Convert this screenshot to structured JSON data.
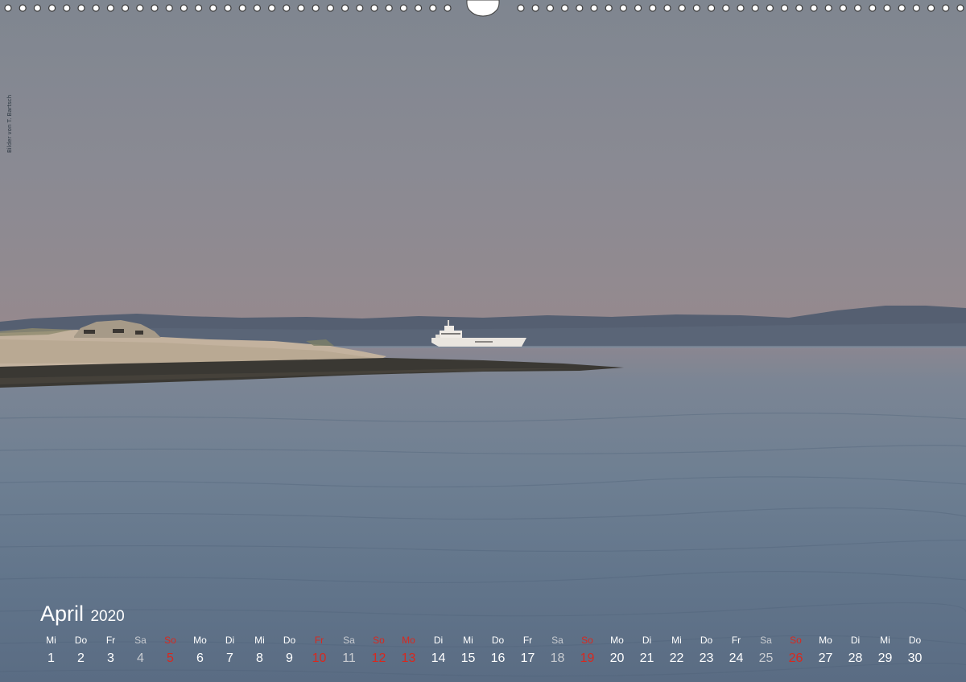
{
  "calendar": {
    "month": "April",
    "year": "2020",
    "credit_text": "Bilder von T. Bartsch",
    "days": [
      {
        "wd": "Mi",
        "n": "1",
        "type": "weekday"
      },
      {
        "wd": "Do",
        "n": "2",
        "type": "weekday"
      },
      {
        "wd": "Fr",
        "n": "3",
        "type": "weekday"
      },
      {
        "wd": "Sa",
        "n": "4",
        "type": "sat"
      },
      {
        "wd": "So",
        "n": "5",
        "type": "sun"
      },
      {
        "wd": "Mo",
        "n": "6",
        "type": "weekday"
      },
      {
        "wd": "Di",
        "n": "7",
        "type": "weekday"
      },
      {
        "wd": "Mi",
        "n": "8",
        "type": "weekday"
      },
      {
        "wd": "Do",
        "n": "9",
        "type": "weekday"
      },
      {
        "wd": "Fr",
        "n": "10",
        "type": "holiday"
      },
      {
        "wd": "Sa",
        "n": "11",
        "type": "sat"
      },
      {
        "wd": "So",
        "n": "12",
        "type": "sun"
      },
      {
        "wd": "Mo",
        "n": "13",
        "type": "holiday"
      },
      {
        "wd": "Di",
        "n": "14",
        "type": "weekday"
      },
      {
        "wd": "Mi",
        "n": "15",
        "type": "weekday"
      },
      {
        "wd": "Do",
        "n": "16",
        "type": "weekday"
      },
      {
        "wd": "Fr",
        "n": "17",
        "type": "weekday"
      },
      {
        "wd": "Sa",
        "n": "18",
        "type": "sat"
      },
      {
        "wd": "So",
        "n": "19",
        "type": "sun"
      },
      {
        "wd": "Mo",
        "n": "20",
        "type": "weekday"
      },
      {
        "wd": "Di",
        "n": "21",
        "type": "weekday"
      },
      {
        "wd": "Mi",
        "n": "22",
        "type": "weekday"
      },
      {
        "wd": "Do",
        "n": "23",
        "type": "weekday"
      },
      {
        "wd": "Fr",
        "n": "24",
        "type": "weekday"
      },
      {
        "wd": "Sa",
        "n": "25",
        "type": "sat"
      },
      {
        "wd": "So",
        "n": "26",
        "type": "sun"
      },
      {
        "wd": "Mo",
        "n": "27",
        "type": "weekday"
      },
      {
        "wd": "Di",
        "n": "28",
        "type": "weekday"
      },
      {
        "wd": "Mi",
        "n": "29",
        "type": "weekday"
      },
      {
        "wd": "Do",
        "n": "30",
        "type": "weekday"
      }
    ]
  },
  "colors": {
    "sunday_red": "#d9281e",
    "text_white": "#ffffff",
    "saturday_gray": "#c9ccd1"
  },
  "icons": {
    "binding": "spiral-binding-icon",
    "ship": "ferry-ship-icon"
  }
}
